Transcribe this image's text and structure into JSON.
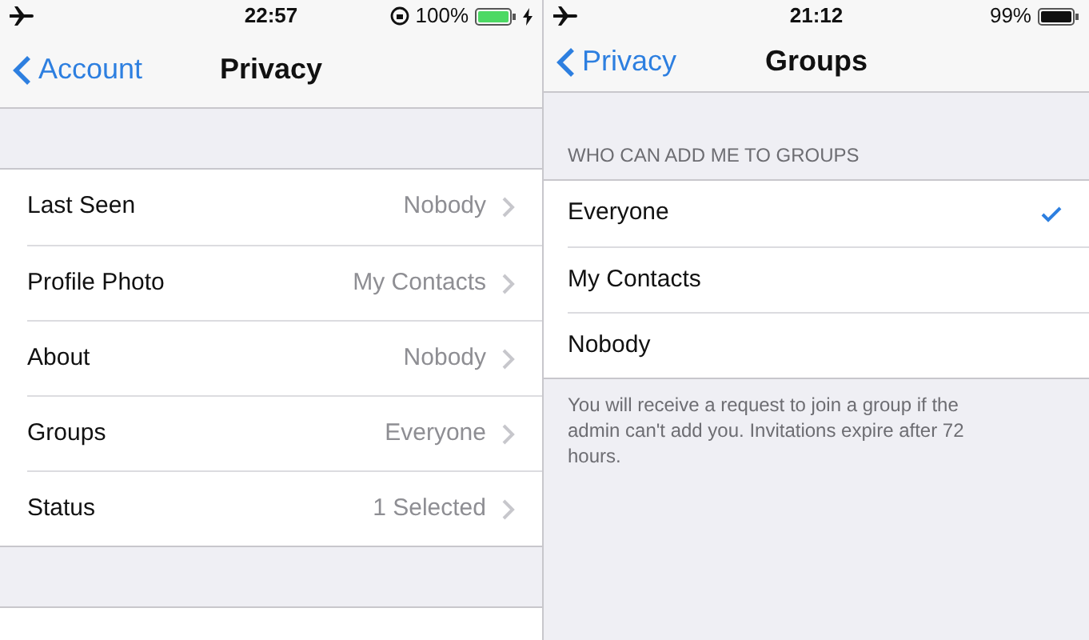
{
  "screens": [
    {
      "status_bar": {
        "time": "22:57",
        "battery": "100%"
      },
      "nav": {
        "back": "Account",
        "title": "Privacy"
      },
      "rows": [
        {
          "label": "Last Seen",
          "value": "Nobody"
        },
        {
          "label": "Profile Photo",
          "value": "My Contacts"
        },
        {
          "label": "About",
          "value": "Nobody"
        },
        {
          "label": "Groups",
          "value": "Everyone"
        },
        {
          "label": "Status",
          "value": "1 Selected"
        }
      ]
    },
    {
      "status_bar": {
        "time": "21:12",
        "battery": "99%"
      },
      "nav": {
        "back": "Privacy",
        "title": "Groups"
      },
      "section_header": "WHO CAN ADD ME TO GROUPS",
      "options": [
        {
          "label": "Everyone",
          "selected": true
        },
        {
          "label": "My Contacts",
          "selected": false
        },
        {
          "label": "Nobody",
          "selected": false
        }
      ],
      "footer": "You will receive a request to join a group if the admin can't add you. Invitations expire after 72 hours."
    }
  ]
}
